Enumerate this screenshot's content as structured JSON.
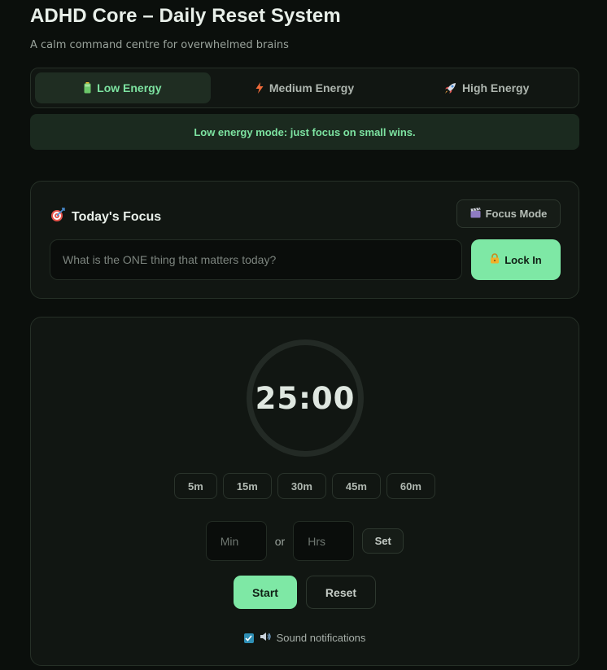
{
  "header": {
    "title": "ADHD Core – Daily Reset System",
    "subtitle": "A calm command centre for overwhelmed brains"
  },
  "energy": {
    "options": [
      {
        "label": "Low Energy",
        "icon": "battery-icon",
        "active": true
      },
      {
        "label": "Medium Energy",
        "icon": "lightning-icon",
        "active": false
      },
      {
        "label": "High Energy",
        "icon": "rocket-icon",
        "active": false
      }
    ],
    "message": "Low energy mode: just focus on small wins."
  },
  "focus": {
    "title": "Today's Focus",
    "focus_mode_label": "Focus Mode",
    "input_placeholder": "What is the ONE thing that matters today?",
    "lock_label": "Lock In"
  },
  "timer": {
    "display": "25:00",
    "presets": [
      "5m",
      "15m",
      "30m",
      "45m",
      "60m"
    ],
    "min_placeholder": "Min",
    "or_text": "or",
    "hrs_placeholder": "Hrs",
    "set_label": "Set",
    "start_label": "Start",
    "reset_label": "Reset",
    "sound_label": "Sound notifications",
    "sound_enabled": true
  },
  "colors": {
    "accent": "#7ee8a5",
    "background": "#0b0f0c",
    "card": "#111612"
  }
}
